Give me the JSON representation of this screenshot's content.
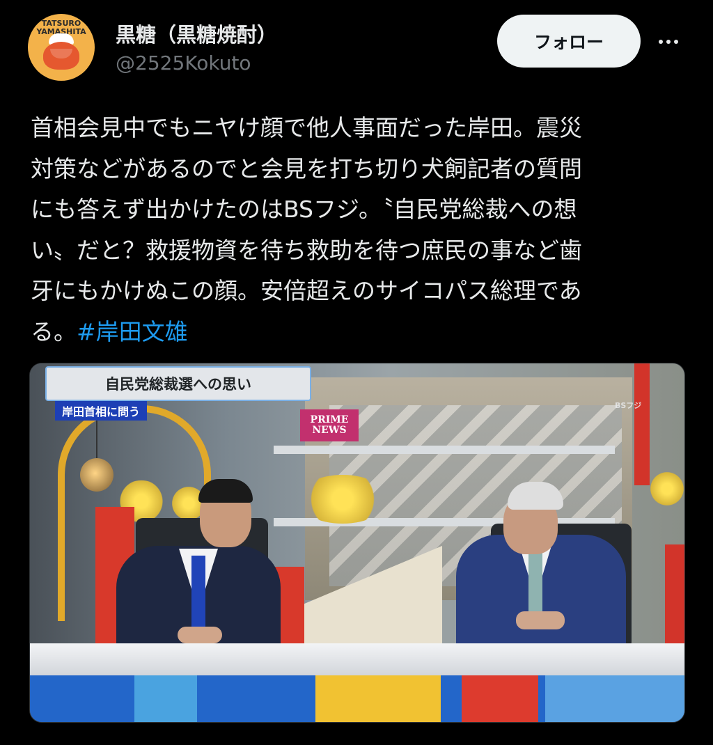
{
  "author": {
    "avatar_text_line1": "TATSURO",
    "avatar_text_line2": "YAMASHITA",
    "display_name": "黒糖（黒糖焼酎）",
    "handle": "@2525Kokuto"
  },
  "actions": {
    "follow_label": "フォロー",
    "more_icon": "more-horizontal-icon"
  },
  "tweet": {
    "lines": [
      "首相会見中でもニヤけ顔で他人事面だった岸田。震災",
      "対策などがあるのでと会見を打ち切り犬飼記者の質問",
      "にも答えず出かけたのはBSフジ。〝自民党総裁への想",
      "い〟だと？救援物資を待ち救助を待つ庶民の事など歯",
      "牙にもかけぬこの顔。安倍超えのサイコパス総理であ"
    ],
    "last_line_prefix": "る。",
    "hashtag": "#岸田文雄"
  },
  "media": {
    "caption_main": "自民党総裁選への思い",
    "caption_sub": "岸田首相に問う",
    "show_logo_line1": "PRIME",
    "show_logo_line2": "NEWS",
    "channel_logo": "BSフジ"
  },
  "colors": {
    "background": "#000000",
    "text": "#e7e9ea",
    "secondary_text": "#71767b",
    "link": "#1d9bf0",
    "follow_button_bg": "#eff3f4"
  }
}
